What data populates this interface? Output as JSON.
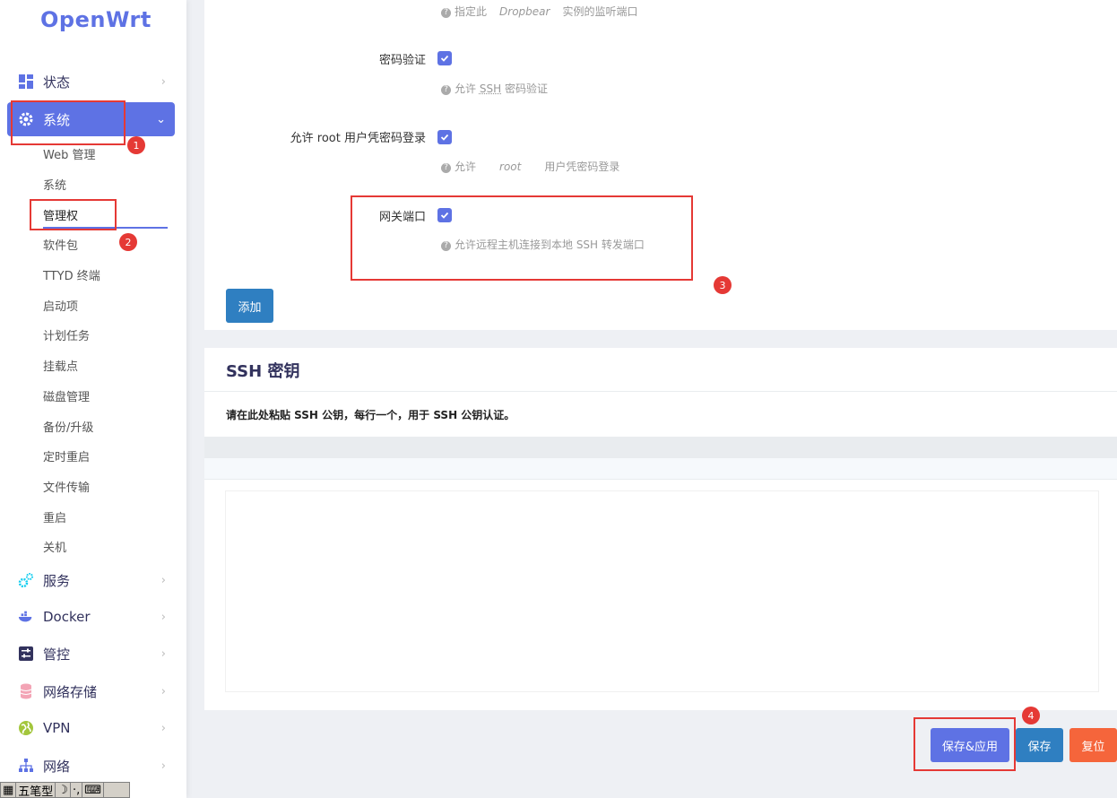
{
  "brand": {
    "logo": "OpenWrt"
  },
  "sidebar": {
    "items": [
      {
        "label": "状态",
        "icon": "dashboard-icon"
      },
      {
        "label": "系统",
        "icon": "gear-icon"
      },
      {
        "label": "服务",
        "icon": "cogs-icon"
      },
      {
        "label": "Docker",
        "icon": "docker-icon"
      },
      {
        "label": "管控",
        "icon": "sliders-icon"
      },
      {
        "label": "网络存储",
        "icon": "database-icon"
      },
      {
        "label": "VPN",
        "icon": "globe-icon"
      },
      {
        "label": "网络",
        "icon": "network-icon"
      }
    ],
    "system_sub": [
      "Web 管理",
      "系统",
      "管理权",
      "软件包",
      "TTYD 终端",
      "启动项",
      "计划任务",
      "挂载点",
      "磁盘管理",
      "备份/升级",
      "定时重启",
      "文件传输",
      "重启",
      "关机"
    ]
  },
  "form": {
    "port_hint_prefix": "指定此",
    "port_hint_em": "Dropbear",
    "port_hint_suffix": "实例的监听端口",
    "password_auth": {
      "label": "密码验证",
      "checked": true,
      "hint_prefix": "允许",
      "hint_abbr": "SSH",
      "hint_suffix": "密码验证"
    },
    "root_password": {
      "label": "允许 root 用户凭密码登录",
      "checked": true,
      "hint_prefix": "允许",
      "hint_em": "root",
      "hint_suffix": "用户凭密码登录"
    },
    "gateway_ports": {
      "label": "网关端口",
      "checked": true,
      "hint": "允许远程主机连接到本地 SSH 转发端口"
    },
    "add_button": "添加"
  },
  "ssh_keys": {
    "title": "SSH 密钥",
    "description": "请在此处粘贴 SSH 公钥，每行一个，用于 SSH 公钥认证。",
    "textarea_value": ""
  },
  "actions": {
    "save_apply": "保存&应用",
    "save": "保存",
    "reset": "复位"
  },
  "annotations": {
    "badges": [
      "1",
      "2",
      "3",
      "4"
    ]
  },
  "ime": {
    "label": "五笔型"
  },
  "colors": {
    "accent": "#5e72e4",
    "save": "#2f7fc1",
    "reset": "#f5653b",
    "annotation": "#e53935"
  }
}
